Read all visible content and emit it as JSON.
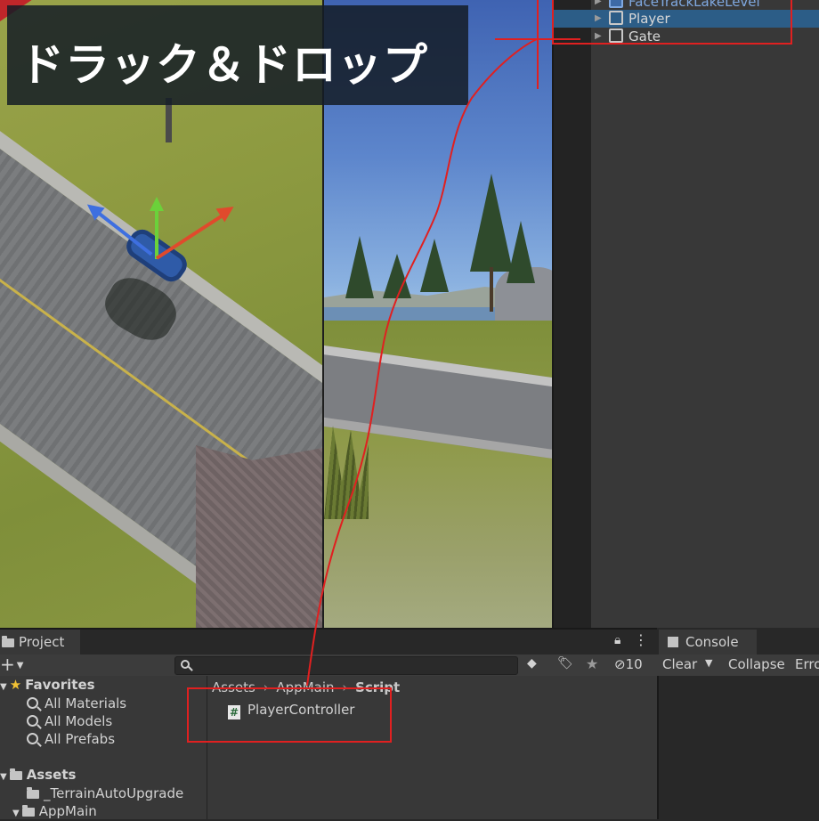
{
  "caption": "ドラック＆ドロップ",
  "hierarchy": {
    "items": [
      {
        "label": "FaceTrackLakeLevel"
      },
      {
        "label": "Player"
      },
      {
        "label": "Gate"
      }
    ]
  },
  "project": {
    "tab_label": "Project",
    "add_label": "+",
    "hidden_count": "10",
    "breadcrumb": [
      "Assets",
      "AppMain",
      "Script"
    ],
    "favorites": {
      "header": "Favorites",
      "items": [
        "All Materials",
        "All Models",
        "All Prefabs"
      ]
    },
    "assets": {
      "header": "Assets",
      "items": [
        "_TerrainAutoUpgrade",
        "AppMain"
      ]
    },
    "files": [
      {
        "name": "PlayerController",
        "icon": "csharp-script-icon"
      }
    ]
  },
  "console": {
    "tab_label": "Console",
    "clear_label": "Clear",
    "collapse_label": "Collapse",
    "error_label": "Erro"
  },
  "colors": {
    "selection": "#2c5d87",
    "annotation": "#e02020",
    "panel": "#383838"
  }
}
